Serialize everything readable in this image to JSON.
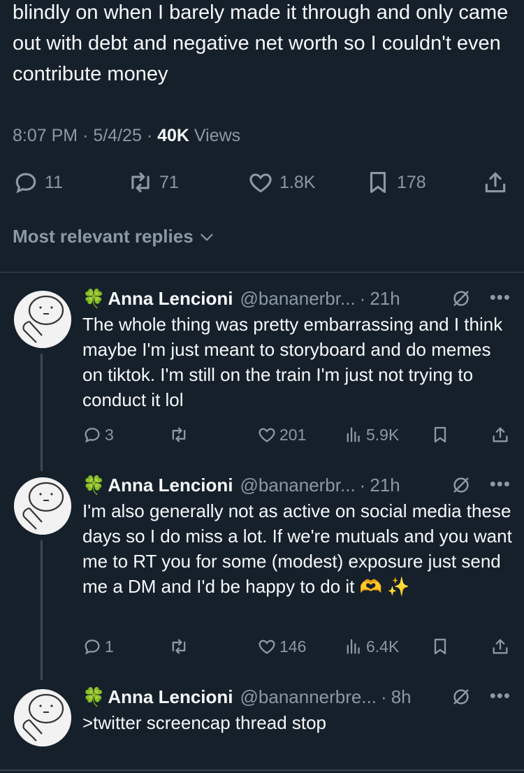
{
  "tweet": {
    "text": "blindly on when I barely made it through and only came out with debt and negative net worth so I couldn't even contribute money",
    "time": "8:07 PM",
    "date": "5/4/25",
    "views_count": "40K",
    "views_label": "Views",
    "replies": "11",
    "reposts": "71",
    "likes": "1.8K",
    "bookmarks": "178"
  },
  "sort_label": "Most relevant replies",
  "replies": [
    {
      "name": "Anna Lencioni",
      "handle": "@bananerbr...",
      "time": "21h",
      "text": "The whole thing was pretty embarrassing and I think maybe I'm just meant to storyboard and do memes on tiktok. I'm still on the train I'm just not trying to conduct it lol",
      "replies": "3",
      "reposts": "",
      "likes": "201",
      "views": "5.9K"
    },
    {
      "name": "Anna Lencioni",
      "handle": "@bananerbr...",
      "time": "21h",
      "text": "I'm also generally not as active on social media these days so I do miss a lot. If we're mutuals and you want me to RT you for some (modest) exposure just send me a DM and I'd be happy to do it 🫶 ✨",
      "replies": "1",
      "reposts": "",
      "likes": "146",
      "views": "6.4K"
    },
    {
      "name": "Anna Lencioni",
      "handle": "@banannerbre...",
      "time": "8h",
      "text": ">twitter screencap thread stop"
    }
  ],
  "icons": {
    "reply": "speech-bubble-icon",
    "repost": "repost-arrows-icon",
    "like": "heart-icon",
    "bookmark": "bookmark-icon",
    "share": "share-upload-icon",
    "views": "bar-chart-icon",
    "grok": "grok-slash-icon",
    "more": "more-dots-icon",
    "clover": "four-leaf-clover-icon"
  },
  "colors": {
    "background": "#15202b",
    "text": "#f7f9f9",
    "secondary": "#8b98a5",
    "divider": "#38444d"
  }
}
